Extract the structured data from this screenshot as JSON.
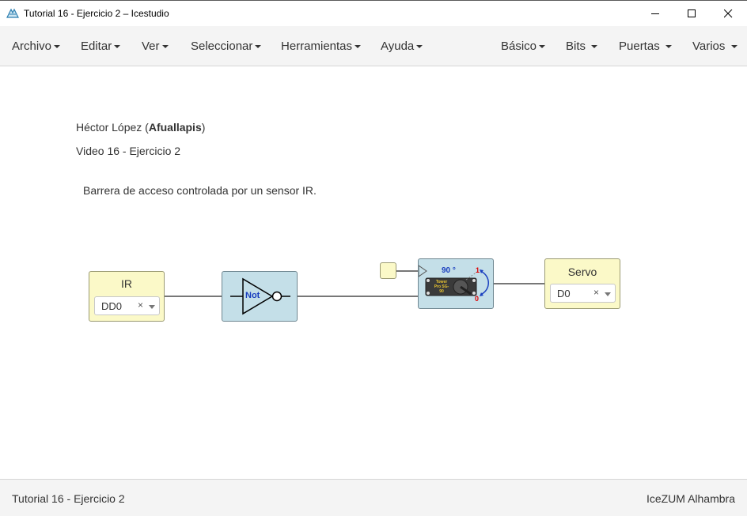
{
  "window": {
    "title": "Tutorial 16 - Ejercicio 2 – Icestudio"
  },
  "menu": {
    "left": [
      "Archivo",
      "Editar",
      "Ver",
      "Seleccionar",
      "Herramientas",
      "Ayuda"
    ],
    "right": [
      "Básico",
      "Bits",
      "Puertas",
      "Varios"
    ]
  },
  "info": {
    "author_name": "Héctor López (",
    "author_nick": "Afuallapis",
    "author_close": ")",
    "subtitle": "Video 16 - Ejercicio 2",
    "description": "Barrera de acceso controlada por un sensor IR."
  },
  "blocks": {
    "input": {
      "label": "IR",
      "pin": "DD0",
      "clear": "×"
    },
    "not_gate": {
      "label": "Not"
    },
    "servo_module": {
      "angle": "90 °",
      "mark_high": "1",
      "mark_low": "0",
      "chip_text": "Tower Pro SG-90"
    },
    "output": {
      "label": "Servo",
      "pin": "D0",
      "clear": "×"
    }
  },
  "footer": {
    "left": "Tutorial 16 - Ejercicio 2",
    "right": "IceZUM Alhambra"
  },
  "colors": {
    "io_block": "#fbf9c8",
    "logic_block": "#c4dfe8",
    "wire": "#777777",
    "angle_text": "#1a3fbf"
  }
}
